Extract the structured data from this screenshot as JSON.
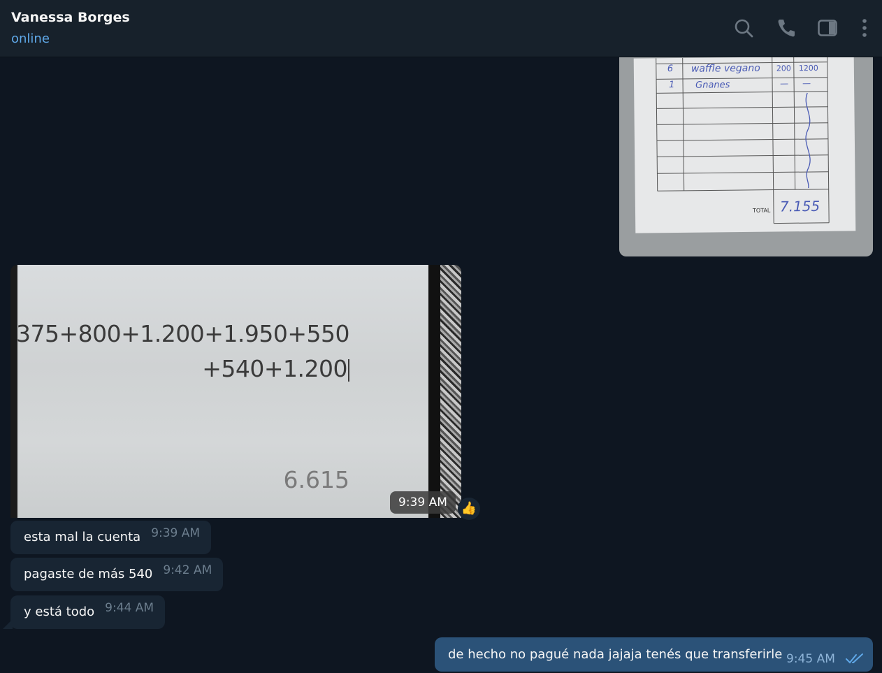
{
  "header": {
    "contact_name": "Vanessa Borges",
    "status": "online",
    "icons": [
      "search-icon",
      "phone-icon",
      "sidebar-toggle-icon",
      "more-icon"
    ]
  },
  "receipt_photo": {
    "rows": [
      {
        "qty": "6",
        "item": "waffle vegano",
        "price": "200",
        "subtotal": "1200"
      },
      {
        "qty": "1",
        "item": "Gnanes",
        "price": "—",
        "subtotal": "—"
      }
    ],
    "total_label": "TOTAL",
    "total_value": "7.155"
  },
  "calculator_photo": {
    "line1": "375+800+1.200+1.950+550",
    "line2": "+540+1.200",
    "result": "6.615",
    "time": "9:39 AM",
    "reaction": "👍"
  },
  "messages": [
    {
      "direction": "in",
      "text": "esta mal la cuenta",
      "time": "9:39 AM"
    },
    {
      "direction": "in",
      "text": "pagaste de más 540",
      "time": "9:42 AM"
    },
    {
      "direction": "in",
      "text": "y está todo",
      "time": "9:44 AM"
    },
    {
      "direction": "out",
      "text": "de hecho no pagué nada jajaja tenés que transferirle",
      "time": "9:45 AM",
      "status": "read"
    }
  ],
  "colors": {
    "background": "#0e1621",
    "header": "#17212b",
    "incoming_bubble": "#182533",
    "outgoing_bubble": "#2b5278",
    "accent": "#5fa8e8"
  }
}
